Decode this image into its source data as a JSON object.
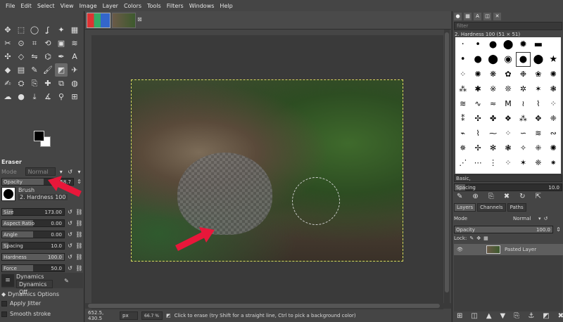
{
  "menubar": [
    "File",
    "Edit",
    "Select",
    "View",
    "Image",
    "Layer",
    "Colors",
    "Tools",
    "Filters",
    "Windows",
    "Help"
  ],
  "tools": [
    "move-icon",
    "rect-select-icon",
    "ellipse-select-icon",
    "lasso-icon",
    "fuzzy-select-icon",
    "by-color-select-icon",
    "scissors-icon",
    "foreground-select-icon",
    "crop-icon",
    "transform-icon",
    "unified-transform-icon",
    "warp-icon",
    "handle-transform-icon",
    "perspective-icon",
    "flip-icon",
    "cage-icon",
    "paths-icon",
    "text-icon",
    "bucket-fill-icon",
    "gradient-icon",
    "pencil-icon",
    "paintbrush-icon",
    "eraser-icon",
    "airbrush-icon",
    "ink-icon",
    "mypaint-icon",
    "clone-icon",
    "heal-icon",
    "perspective-clone-icon",
    "blur-icon",
    "smudge-icon",
    "dodge-burn-icon",
    "color-picker-icon",
    "measure-icon",
    "zoom-icon",
    "align-icon"
  ],
  "tool_glyphs": [
    "✥",
    "⬚",
    "◯",
    "ʆ",
    "✦",
    "▦",
    "✂",
    "⊙",
    "⌗",
    "⟲",
    "▣",
    "≋",
    "✣",
    "◇",
    "⇋",
    "⌬",
    "✒",
    "A",
    "◆",
    "▤",
    "✎",
    "🖌",
    "◩",
    "✈",
    "✍",
    "⛭",
    "⎘",
    "✚",
    "⧉",
    "◍",
    "☁",
    "●",
    "⤓",
    "∡",
    "⚲",
    "⊞"
  ],
  "tool_options": {
    "title": "Eraser",
    "mode_label": "Mode",
    "mode_value": "Normal",
    "opacity_label": "Opacity",
    "opacity_value": "58.7",
    "opacity_fraction": 0.587,
    "brush_label": "Brush",
    "brush_value": "2. Hardness 100",
    "sliders": [
      {
        "label": "Size",
        "value": "173.00",
        "fraction": 0.17
      },
      {
        "label": "Aspect Ratio",
        "value": "0.00",
        "fraction": 0.5
      },
      {
        "label": "Angle",
        "value": "0.00",
        "fraction": 0.5
      },
      {
        "label": "Spacing",
        "value": "10.0",
        "fraction": 0.1
      },
      {
        "label": "Hardness",
        "value": "100.0",
        "fraction": 1.0
      },
      {
        "label": "Force",
        "value": "50.0",
        "fraction": 0.5
      }
    ],
    "dynamics_label": "Dynamics",
    "dynamics_value": "Dynamics Off",
    "dynamics_options": "Dynamics Options",
    "apply_jitter": "Apply Jitter",
    "smooth_stroke": "Smooth stroke"
  },
  "status": {
    "coords": "652.5, 430.5",
    "unit": "px",
    "zoom": "66.7 %",
    "message": "Click to erase (try Shift for a straight line, Ctrl to pick a background color)"
  },
  "brushes": {
    "filter_placeholder": "filter",
    "selected": "2. Hardness 100 (51 × 51)",
    "preset": "Basic,",
    "spacing_label": "Spacing",
    "spacing_value": "10.0"
  },
  "layers": {
    "tabs": [
      "Layers",
      "Channels",
      "Paths"
    ],
    "mode_label": "Mode",
    "mode_value": "Normal",
    "opacity_label": "Opacity",
    "opacity_value": "100.0",
    "lock_label": "Lock:",
    "layer_name": "Pasted Layer"
  },
  "colors": {
    "arrow": "#e8173a",
    "accent": "#5e5e5e"
  }
}
